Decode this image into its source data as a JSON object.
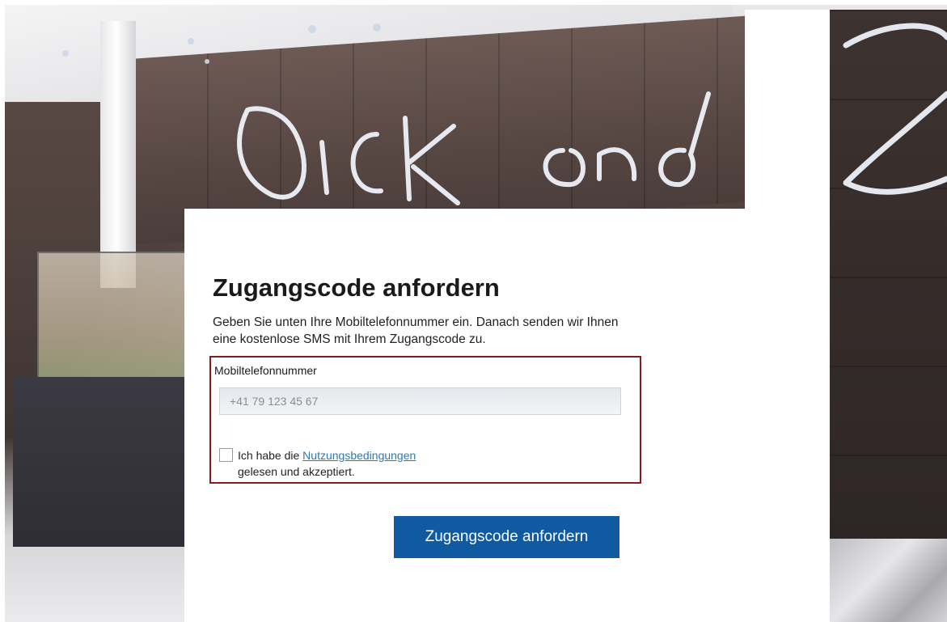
{
  "background": {
    "neon_text_left": "Dick",
    "neon_text_middle": "and"
  },
  "form": {
    "title": "Zugangscode anfordern",
    "intro": "Geben Sie unten Ihre Mobiltelefonnummer ein. Danach senden wir Ihnen eine kostenlose SMS mit Ihrem Zugangscode zu.",
    "phone_label": "Mobiltelefonnummer",
    "phone_placeholder": "+41 79 123 45 67",
    "phone_value": "",
    "terms_prefix": "Ich habe die ",
    "terms_link": "Nutzungsbedingungen",
    "terms_suffix": "gelesen und akzeptiert.",
    "terms_checked": false,
    "submit_label": "Zugangscode anfordern"
  },
  "colors": {
    "button_bg": "#0f5aa0",
    "link": "#2a7ab0",
    "error_border": "#8b1a1a"
  }
}
